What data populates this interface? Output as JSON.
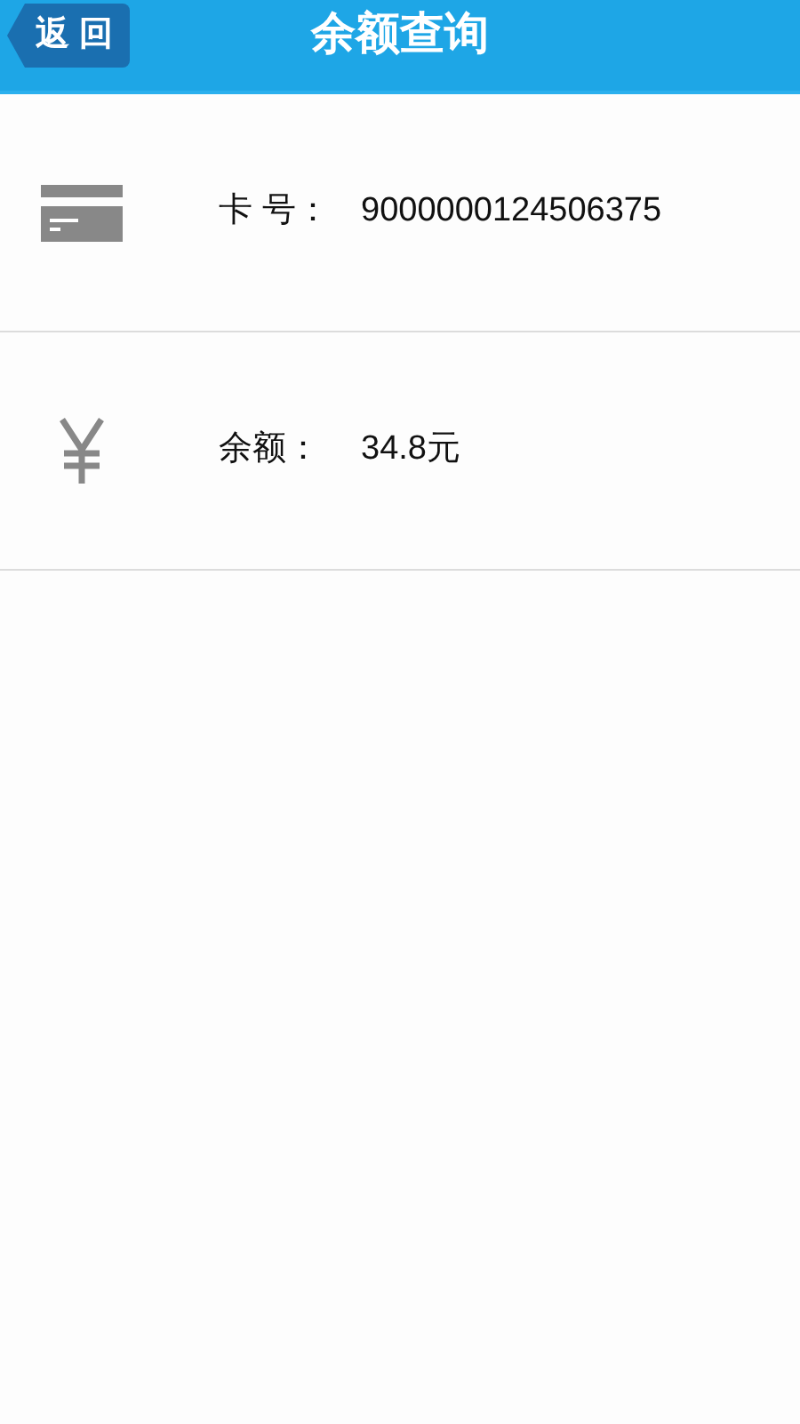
{
  "header": {
    "back": "返 回",
    "title": "余额查询"
  },
  "rows": [
    {
      "kind": "card",
      "label": "卡 号：",
      "value": "9000000124506375"
    },
    {
      "kind": "yen",
      "label": "余额：",
      "value": "34.8元"
    }
  ]
}
